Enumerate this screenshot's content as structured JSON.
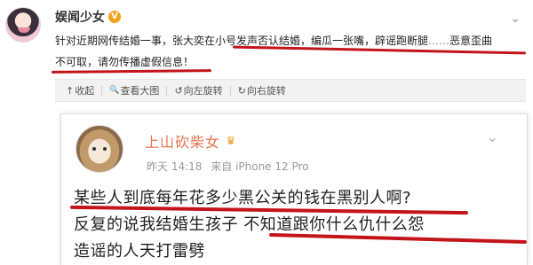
{
  "post": {
    "author": "娱闻少女",
    "verified_badge": "V",
    "menu_icon": "chevron-down-icon",
    "text_line1": "针对近期网传结婚一事，张大奕在小号发声否认结婚，编瓜一张嘴，辟谣跑断腿",
    "ellipsis": "……",
    "text_line1_tail": "恶意歪曲",
    "text_line2": "不可取，请勿传播虚假信息！"
  },
  "toolbar": {
    "items": [
      {
        "icon": "collapse-icon",
        "glyph": "↑",
        "label": "收起"
      },
      {
        "icon": "zoom-icon",
        "glyph": "🔍",
        "label": "查看大图"
      },
      {
        "icon": "rotate-left-icon",
        "glyph": "↺",
        "label": "向左旋转"
      },
      {
        "icon": "rotate-right-icon",
        "glyph": "↻",
        "label": "向右旋转"
      }
    ]
  },
  "embed": {
    "author": "上山砍柴女",
    "crown_icon": "crown-icon",
    "time": "昨天 14:18",
    "source": "来自 iPhone 12 Pro",
    "line1": "某些人到底每年花多少黑公关的钱在黑别人啊?",
    "line2": "反复的说我结婚生孩子 不知道跟你什么仇什么怨",
    "line3": "造谣的人天打雷劈"
  },
  "colors": {
    "underline_marker": "#c4141b",
    "embed_author": "#eb7350",
    "verified": "#f7a21c"
  }
}
